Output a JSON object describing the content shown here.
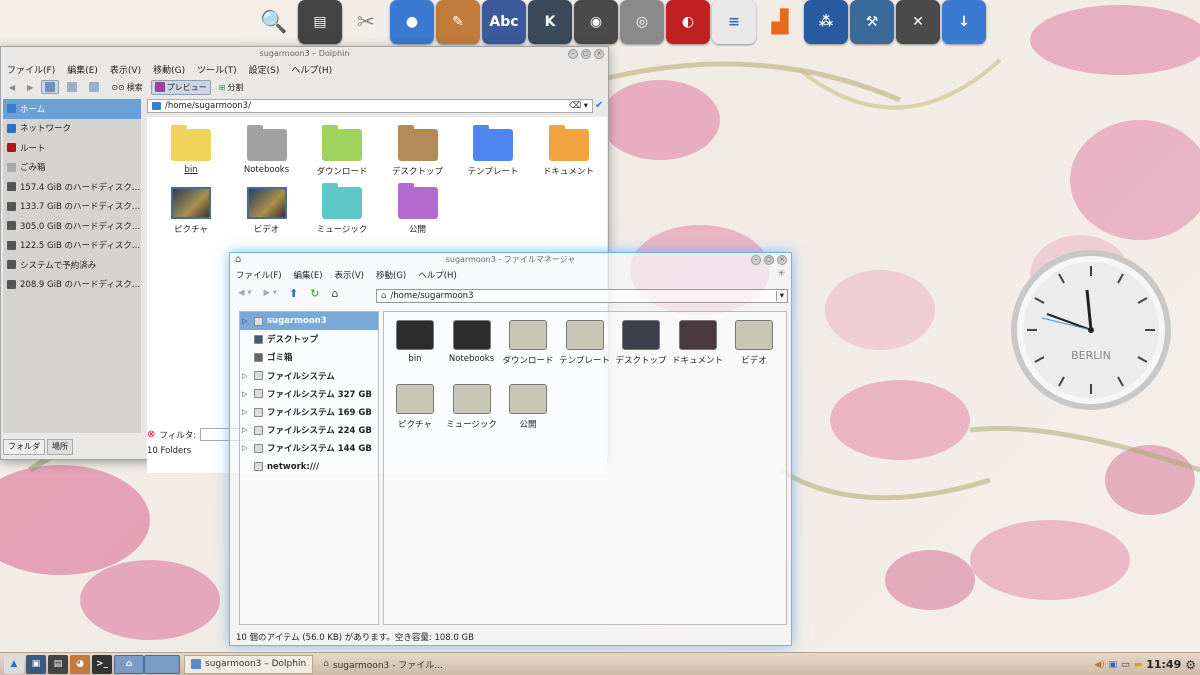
{
  "dolphin": {
    "title": "sugarmoon3 – Dolphin",
    "menu": [
      "ファイル(F)",
      "編集(E)",
      "表示(V)",
      "移動(G)",
      "ツール(T)",
      "設定(S)",
      "ヘルプ(H)"
    ],
    "toolbar": {
      "search": "検索",
      "preview": "プレビュー",
      "split": "分割"
    },
    "places": [
      {
        "label": "ホーム",
        "icon": "home-icon",
        "color": "#3b7bd4"
      },
      {
        "label": "ネットワーク",
        "icon": "globe-icon",
        "color": "#2a6fc0"
      },
      {
        "label": "ルート",
        "icon": "root-folder-icon",
        "color": "#b01818"
      },
      {
        "label": "ごみ箱",
        "icon": "trash-icon",
        "color": "#aaaaaa"
      },
      {
        "label": "157.4 GiB のハードディスク...",
        "icon": "harddisk-icon",
        "color": "#555555"
      },
      {
        "label": "133.7 GiB のハードディスク...",
        "icon": "harddisk-icon",
        "color": "#555555"
      },
      {
        "label": "305.0 GiB のハードディスク...",
        "icon": "harddisk-icon",
        "color": "#555555"
      },
      {
        "label": "122.5 GiB のハードディスク...",
        "icon": "harddisk-icon",
        "color": "#555555"
      },
      {
        "label": "システムで予約済み",
        "icon": "harddisk-icon",
        "color": "#555555"
      },
      {
        "label": "208.9 GiB のハードディスク...",
        "icon": "harddisk-icon",
        "color": "#555555"
      }
    ],
    "path": "/home/sugarmoon3/",
    "items": [
      {
        "label": "bin",
        "color": "#f1d35c"
      },
      {
        "label": "Notebooks",
        "color": "#a2a2a2"
      },
      {
        "label": "ダウンロード",
        "color": "#9fd35e"
      },
      {
        "label": "デスクトップ",
        "color": "#b58a59"
      },
      {
        "label": "テンプレート",
        "color": "#4f86ef"
      },
      {
        "label": "ドキュメント",
        "color": "#f2a441"
      },
      {
        "label": "ピクチャ",
        "color": "thumb"
      },
      {
        "label": "ビデオ",
        "color": "thumb"
      },
      {
        "label": "ミュージック",
        "color": "#5ec7c7"
      },
      {
        "label": "公開",
        "color": "#b46bd0"
      }
    ],
    "tabs": [
      "フォルダ",
      "場所"
    ],
    "filter_label": "フィルタ:",
    "status": "10 Folders"
  },
  "thunar": {
    "title": "sugarmoon3 - ファイルマネージャ",
    "menu": [
      "ファイル(F)",
      "編集(E)",
      "表示(V)",
      "移動(G)",
      "ヘルプ(H)"
    ],
    "path": "/home/sugarmoon3",
    "tree": [
      {
        "label": "sugarmoon3",
        "arrow": "▷",
        "sel": true
      },
      {
        "label": "デスクトップ",
        "arrow": ""
      },
      {
        "label": "ゴミ箱",
        "arrow": ""
      },
      {
        "label": "ファイルシステム",
        "arrow": "▷"
      },
      {
        "label": "ファイルシステム 327 GB",
        "arrow": "▷"
      },
      {
        "label": "ファイルシステム 169 GB",
        "arrow": "▷"
      },
      {
        "label": "ファイルシステム 224 GB",
        "arrow": "▷"
      },
      {
        "label": "ファイルシステム 144 GB",
        "arrow": "▷"
      },
      {
        "label": "network:///",
        "arrow": ""
      }
    ],
    "items": [
      {
        "label": "bin",
        "color": "#2d2d2d"
      },
      {
        "label": "Notebooks",
        "color": "#2d2d2d"
      },
      {
        "label": "ダウンロード",
        "color": "#c8c6b4"
      },
      {
        "label": "テンプレート",
        "color": "#c8c6b4"
      },
      {
        "label": "デスクトップ",
        "color": "#3b3f4a"
      },
      {
        "label": "ドキュメント",
        "color": "#4a3a3f"
      },
      {
        "label": "ビデオ",
        "color": "#c8c6b4"
      },
      {
        "label": "ピクチャ",
        "color": "#c8c6b4"
      },
      {
        "label": "ミュージック",
        "color": "#c8c6b4"
      },
      {
        "label": "公開",
        "color": "#c8c6b4"
      }
    ],
    "status": "10 個のアイテム (56.0 KB) があります。空き容量: 108.0 GB"
  },
  "clock": {
    "city": "BERLIN"
  },
  "dock": [
    {
      "icon": "search-icon",
      "color": "#7aaee6",
      "glyph": "🔍"
    },
    {
      "icon": "file-cabinet-icon",
      "color": "#444444",
      "glyph": "▤"
    },
    {
      "icon": "cutter-icon",
      "color": "#8a8a8a",
      "glyph": "✂"
    },
    {
      "icon": "chrome-icon",
      "color": "#3a7ad0",
      "glyph": "●"
    },
    {
      "icon": "gimp-icon",
      "color": "#c07a3a",
      "glyph": "✎"
    },
    {
      "icon": "abc-editor-icon",
      "color": "#3a5a9a",
      "glyph": "Abc"
    },
    {
      "icon": "kdeconnect-icon",
      "color": "#3a4a5a",
      "glyph": "K"
    },
    {
      "icon": "gwenview-icon",
      "color": "#4a4a4a",
      "glyph": "◉"
    },
    {
      "icon": "camera-icon",
      "color": "#8a8a8a",
      "glyph": "◎"
    },
    {
      "icon": "redshift-icon",
      "color": "#c02020",
      "glyph": "◐"
    },
    {
      "icon": "document-icon",
      "color": "#e8e8e8",
      "glyph": "≡"
    },
    {
      "icon": "shopping-bag-icon",
      "color": "#e86a1a",
      "glyph": "▟"
    },
    {
      "icon": "network-icon",
      "color": "#2a5aa0",
      "glyph": "⁂"
    },
    {
      "icon": "tools-icon",
      "color": "#3a6a9a",
      "glyph": "⚒"
    },
    {
      "icon": "settings-icon",
      "color": "#4a4a4a",
      "glyph": "✕"
    },
    {
      "icon": "download-icon",
      "color": "#3a7ad0",
      "glyph": "↓"
    }
  ],
  "taskbar": {
    "tasks": [
      "sugarmoon3 – Dolphin",
      "sugarmoon3 - ファイル..."
    ],
    "time": "11:49"
  }
}
